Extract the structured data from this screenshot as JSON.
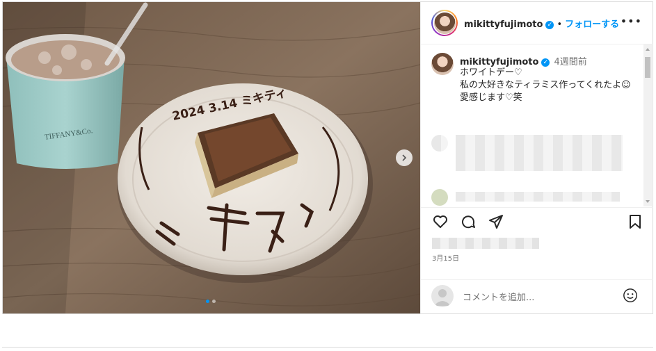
{
  "header": {
    "username": "mikittyfujimoto",
    "separator": "•",
    "follow_label": "フォローする",
    "more_icon": "more-horizontal-icon"
  },
  "caption": {
    "username": "mikittyfujimoto",
    "time": "4週間前",
    "lines": [
      "ホワイトデー♡",
      "私の大好きなティラミス作ってくれたよ☺︎",
      "愛感じます♡笑"
    ]
  },
  "photo": {
    "cup_text": "TIFFANY&Co.",
    "plate_text": "2024 3.14 ミキティ"
  },
  "post": {
    "date": "3月15日"
  },
  "comment_box": {
    "placeholder": "コメントを追加..."
  },
  "colors": {
    "accent": "#0095f6",
    "text": "#262626",
    "muted": "#737373"
  }
}
